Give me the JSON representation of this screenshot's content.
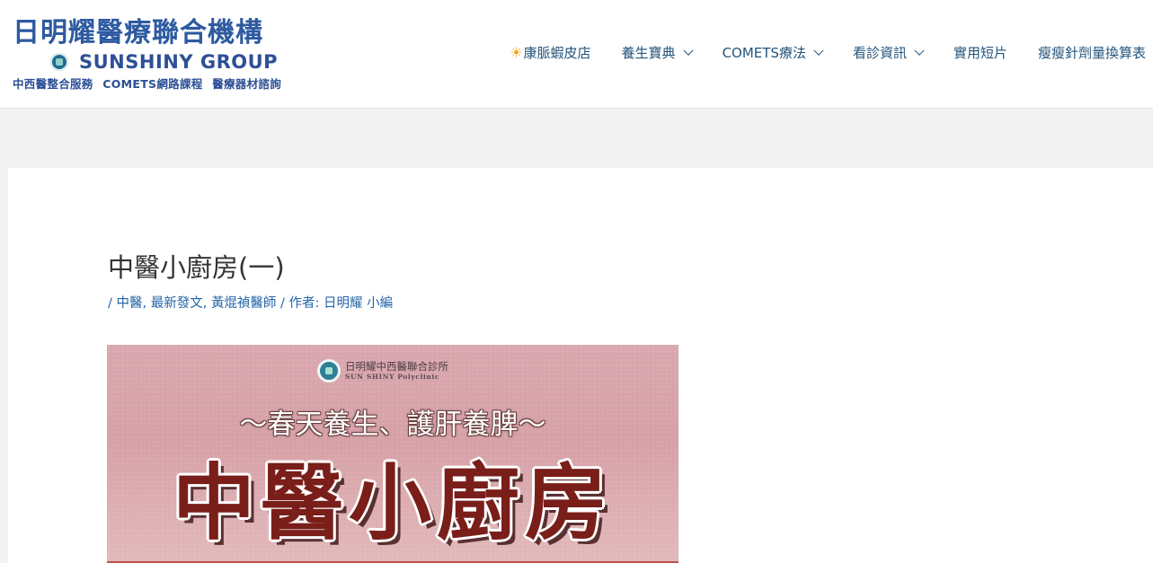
{
  "header": {
    "logo": {
      "title": "日明耀醫療聯合機構",
      "group": "SUNSHINY GROUP",
      "tagline": "中西醫整合服務 COMETS網路課程 醫療器材諮詢"
    },
    "nav": [
      {
        "label": "康脈蝦皮店",
        "icon": "sun-icon",
        "dropdown": false
      },
      {
        "label": "養生寶典",
        "dropdown": true
      },
      {
        "label": "COMETS療法",
        "dropdown": true
      },
      {
        "label": "看診資訊",
        "dropdown": true
      },
      {
        "label": "實用短片",
        "dropdown": false
      },
      {
        "label": "瘦瘦針劑量換算表",
        "dropdown": false
      }
    ]
  },
  "article": {
    "title": "中醫小廚房(一)",
    "meta": {
      "sep1": "/",
      "categories": [
        "中醫",
        "最新發文",
        "黃焜禎醫師"
      ],
      "sep2": "/ 作者:",
      "author": "日明耀 小編"
    },
    "featured_image": {
      "clinic_name": "日明耀中西醫聯合診所",
      "clinic_en": "SUN SHINY Polyclinic",
      "subtitle": "～春天養生、護肝養脾～",
      "title": "中醫小廚房"
    }
  },
  "colors": {
    "nav_text": "#23557d",
    "link": "#2565a8",
    "brand": "#2d5aa0",
    "image_title": "#7a1e1a"
  }
}
